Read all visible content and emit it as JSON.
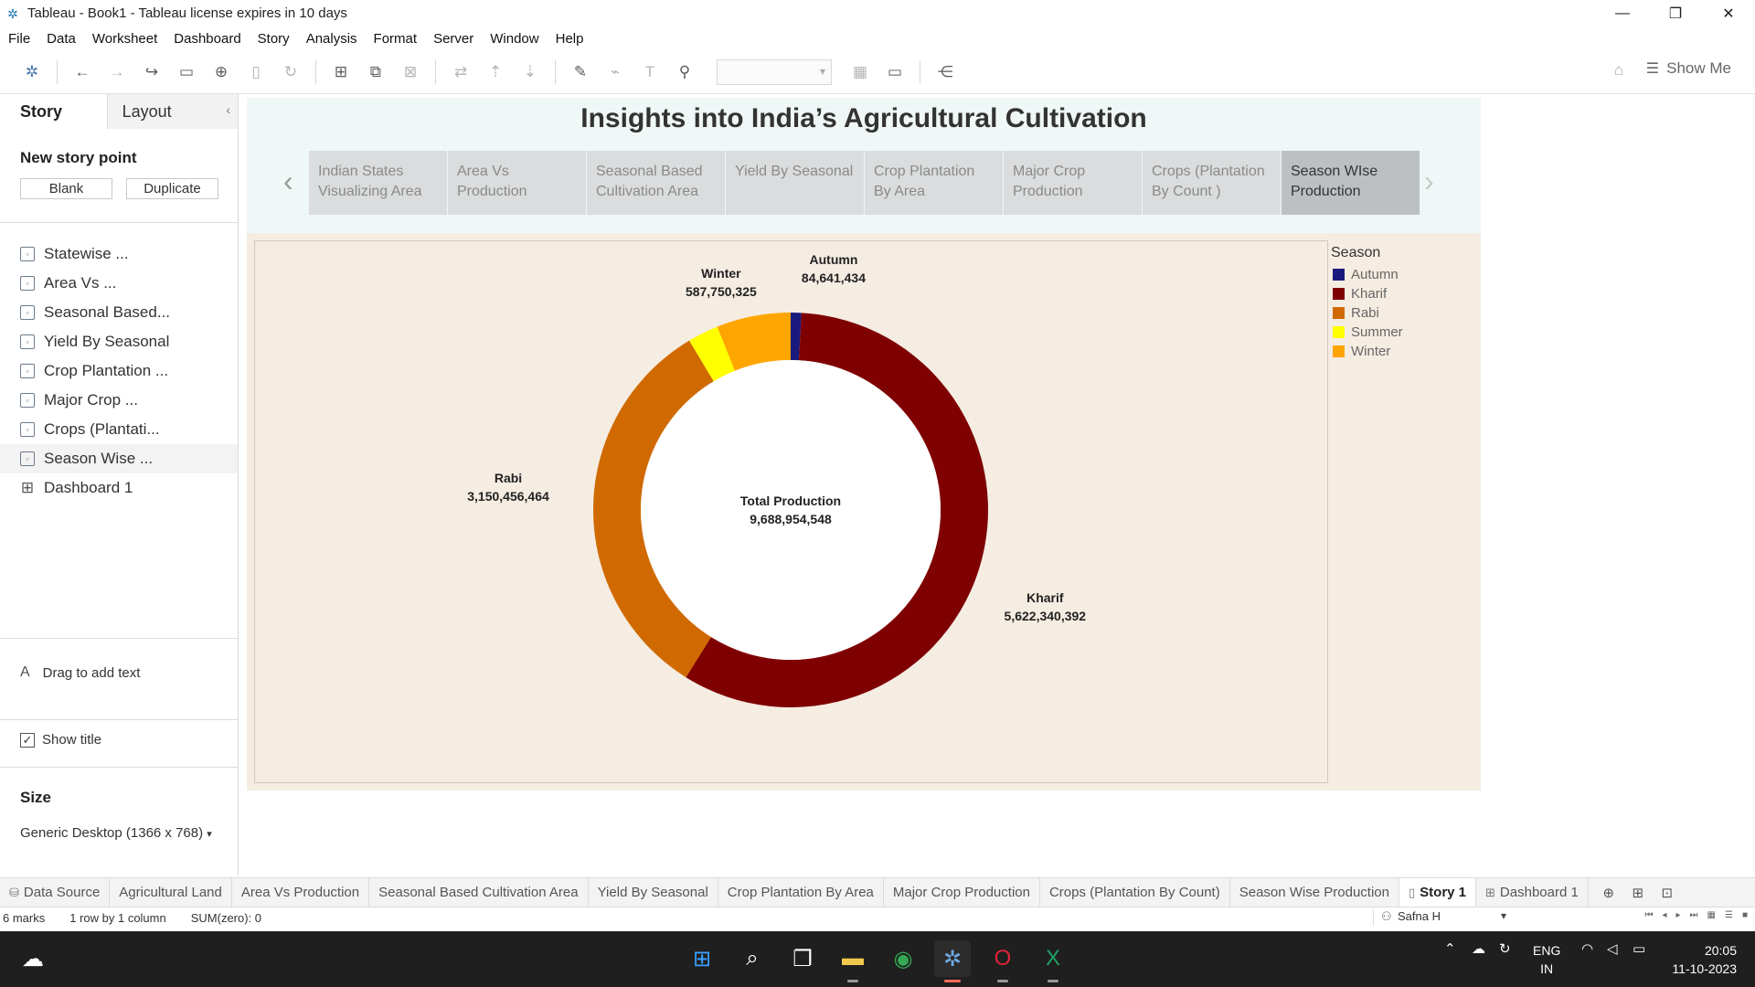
{
  "window": {
    "title": "Tableau - Book1 - Tableau license expires in 10 days"
  },
  "menu": [
    "File",
    "Data",
    "Worksheet",
    "Dashboard",
    "Story",
    "Analysis",
    "Format",
    "Server",
    "Window",
    "Help"
  ],
  "toolbar": {
    "show_me": "Show Me"
  },
  "left_pane": {
    "tabs": {
      "story": "Story",
      "layout": "Layout"
    },
    "new_story_point": "New story point",
    "blank_button": "Blank",
    "duplicate_button": "Duplicate",
    "items": [
      {
        "label": "Statewise ...",
        "kind": "sheet"
      },
      {
        "label": "Area Vs ...",
        "kind": "sheet"
      },
      {
        "label": "Seasonal Based...",
        "kind": "sheet"
      },
      {
        "label": "Yield By Seasonal",
        "kind": "sheet"
      },
      {
        "label": "Crop Plantation ...",
        "kind": "sheet"
      },
      {
        "label": "Major Crop ...",
        "kind": "sheet"
      },
      {
        "label": "Crops (Plantati...",
        "kind": "sheet"
      },
      {
        "label": "Season Wise ...",
        "kind": "sheet",
        "selected": true
      },
      {
        "label": "Dashboard 1",
        "kind": "dashboard"
      }
    ],
    "drag_text": "Drag to add text",
    "show_title": "Show title",
    "size_title": "Size",
    "size_value": "Generic Desktop (1366 x 768)"
  },
  "story": {
    "title": "Insights into India’s Agricultural Cultivation",
    "points": [
      {
        "line1": "Indian States",
        "line2": "Visualizing Area"
      },
      {
        "line1": "Area Vs",
        "line2": "Production"
      },
      {
        "line1": "Seasonal Based",
        "line2": "Cultivation Area"
      },
      {
        "line1": "Yield By Seasonal",
        "line2": ""
      },
      {
        "line1": "Crop Plantation",
        "line2": "By Area"
      },
      {
        "line1": "Major Crop",
        "line2": "Production"
      },
      {
        "line1": "Crops (Plantation",
        "line2": "By Count )"
      },
      {
        "line1": "Season WIse",
        "line2": "Production",
        "active": true
      }
    ]
  },
  "chart_data": {
    "type": "pie",
    "subtype": "donut",
    "center_label": "Total Production",
    "center_value": "9,688,954,548",
    "legend_title": "Season",
    "legend_placement": "right",
    "slices": [
      {
        "name": "Autumn",
        "value": 84641434,
        "label": "84,641,434",
        "color": "#1a1a7e"
      },
      {
        "name": "Kharif",
        "value": 5622340392,
        "label": "5,622,340,392",
        "color": "#7f0000"
      },
      {
        "name": "Rabi",
        "value": 3150456464,
        "label": "3,150,456,464",
        "color": "#d06a00"
      },
      {
        "name": "Summer",
        "value": 243766258,
        "label": "",
        "color": "#ffff00"
      },
      {
        "name": "Winter",
        "value": 587750325,
        "label": "587,750,325",
        "color": "#ffa500"
      }
    ]
  },
  "sheet_tabs": [
    {
      "label": "Data Source",
      "icon": "datasource"
    },
    {
      "label": "Agricultural Land"
    },
    {
      "label": "Area Vs Production"
    },
    {
      "label": "Seasonal Based Cultivation Area"
    },
    {
      "label": "Yield By Seasonal"
    },
    {
      "label": "Crop Plantation By Area"
    },
    {
      "label": "Major Crop Production"
    },
    {
      "label": "Crops (Plantation By Count)"
    },
    {
      "label": "Season Wise Production"
    },
    {
      "label": "Story 1",
      "active": true,
      "icon": "story"
    },
    {
      "label": "Dashboard 1",
      "icon": "dashboard"
    }
  ],
  "status": {
    "marks": "6 marks",
    "rows": "1 row by 1 column",
    "sum": "SUM(zero): 0",
    "user": "Safna H"
  },
  "taskbar": {
    "lang_line1": "ENG",
    "lang_line2": "IN",
    "time": "20:05",
    "date": "11-10-2023"
  }
}
